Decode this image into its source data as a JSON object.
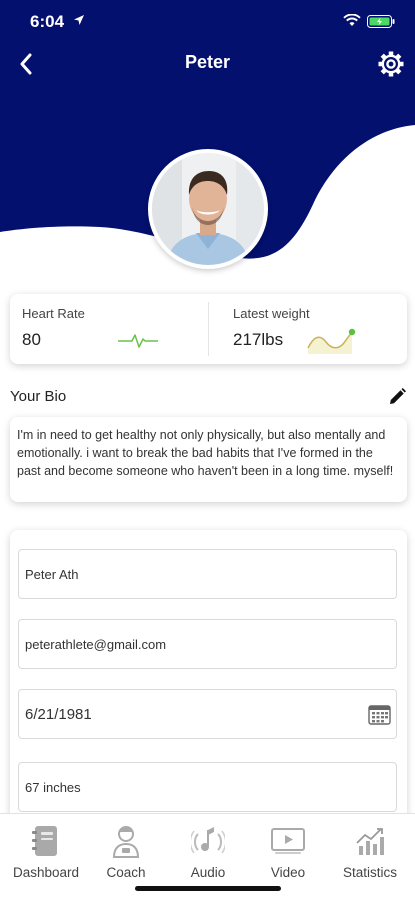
{
  "status_bar": {
    "time": "6:04"
  },
  "header": {
    "title": "Peter",
    "brand_color": "#03106e"
  },
  "stats": {
    "heart_rate": {
      "label": "Heart Rate",
      "value": "80"
    },
    "latest_weight": {
      "label": "Latest weight",
      "value": "217lbs"
    }
  },
  "bio": {
    "heading": "Your Bio",
    "text": "I'm in need to get healthy not only physically, but also mentally and emotionally. i want to break the bad habits that I've formed in the past and become someone who haven't been in a long time. myself!"
  },
  "form": {
    "name": "Peter Ath",
    "email": "peterathlete@gmail.com",
    "birthdate": "6/21/1981",
    "height": "67 inches"
  },
  "nav": {
    "items": [
      {
        "label": "Dashboard",
        "icon": "notebook-icon"
      },
      {
        "label": "Coach",
        "icon": "coach-icon"
      },
      {
        "label": "Audio",
        "icon": "audio-icon"
      },
      {
        "label": "Video",
        "icon": "video-icon"
      },
      {
        "label": "Statistics",
        "icon": "chart-icon"
      }
    ]
  }
}
